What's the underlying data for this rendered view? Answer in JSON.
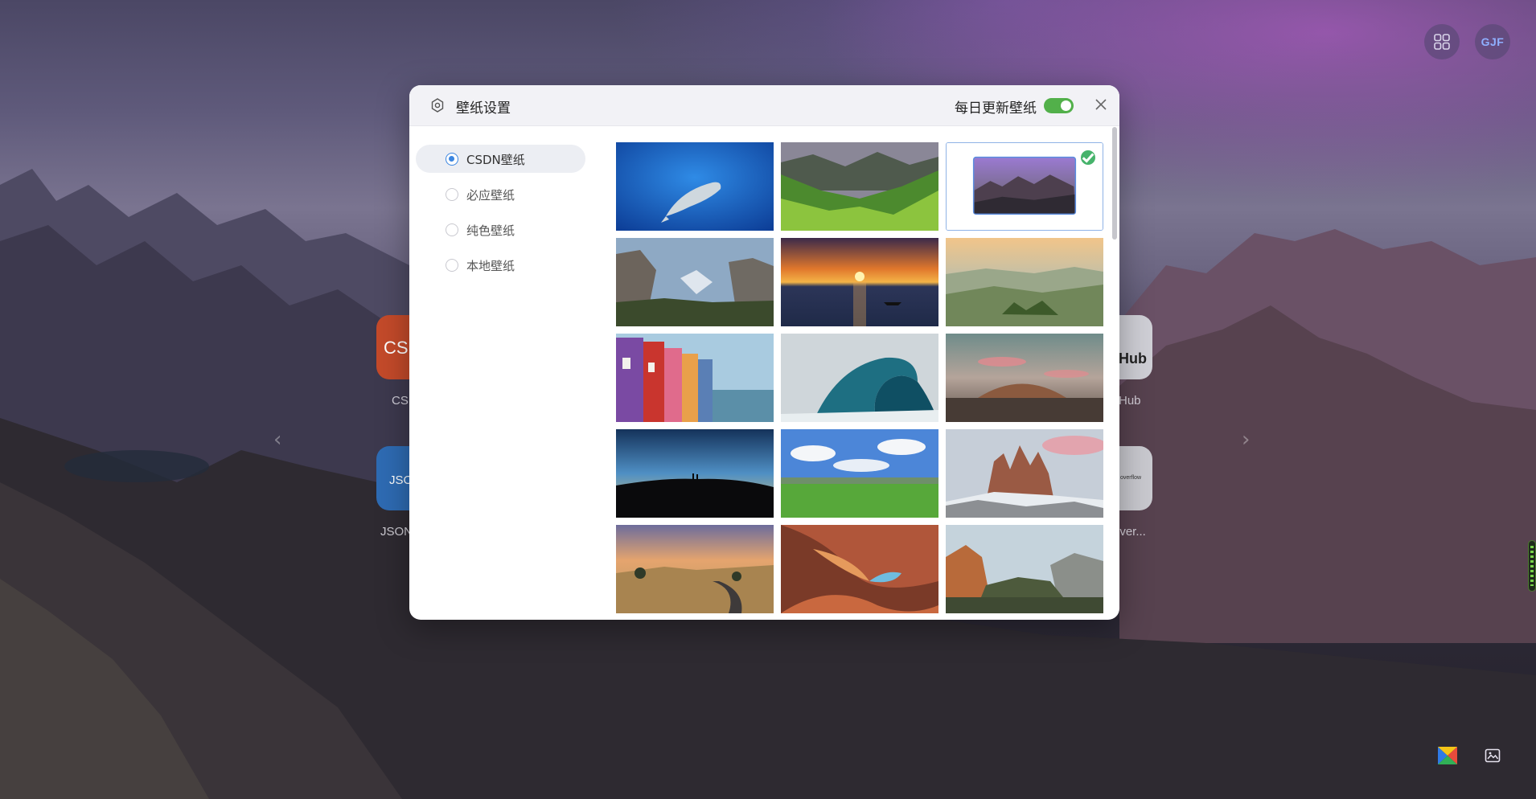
{
  "dialog": {
    "title": "壁纸设置",
    "daily_update_label": "每日更新壁纸",
    "daily_update_on": true,
    "close_icon": "close-icon",
    "settings_icon": "gear-icon"
  },
  "sources": [
    {
      "label": "CSDN壁纸",
      "selected": true
    },
    {
      "label": "必应壁纸",
      "selected": false
    },
    {
      "label": "纯色壁纸",
      "selected": false
    },
    {
      "label": "本地壁纸",
      "selected": false
    }
  ],
  "wallpapers": [
    {
      "subject": "whale-underwater",
      "selected": false
    },
    {
      "subject": "green-valley",
      "selected": false
    },
    {
      "subject": "purple-mountains",
      "selected": true
    },
    {
      "subject": "yosemite-valley",
      "selected": false
    },
    {
      "subject": "sunset-lake-boat",
      "selected": false
    },
    {
      "subject": "misty-hills",
      "selected": false
    },
    {
      "subject": "colorful-houses-canal",
      "selected": false
    },
    {
      "subject": "ocean-wave",
      "selected": false
    },
    {
      "subject": "desert-hill-pink-sky",
      "selected": false
    },
    {
      "subject": "dark-hill-silhouette",
      "selected": false
    },
    {
      "subject": "green-plains-clouds",
      "selected": false
    },
    {
      "subject": "dolomites-peaks",
      "selected": false
    },
    {
      "subject": "desert-road-sunset",
      "selected": false
    },
    {
      "subject": "antelope-canyon",
      "selected": false
    },
    {
      "subject": "canyon-cliffs",
      "selected": false
    }
  ],
  "desktop": {
    "tiles": [
      {
        "label": "CS",
        "text": "CS"
      },
      {
        "label": "Hub",
        "text": "Hub"
      },
      {
        "label": "JSON",
        "text": "JSO"
      },
      {
        "label": "over...",
        "text": "overflow"
      }
    ],
    "avatar_initials": "GJF",
    "apps_icon": "grid-icon",
    "wallpaper_icon": "image-icon",
    "brand_icon": "colorful-logo-icon"
  },
  "colors": {
    "accent": "#3c86e0",
    "toggle_on": "#52b04a",
    "check": "#46b36b"
  }
}
